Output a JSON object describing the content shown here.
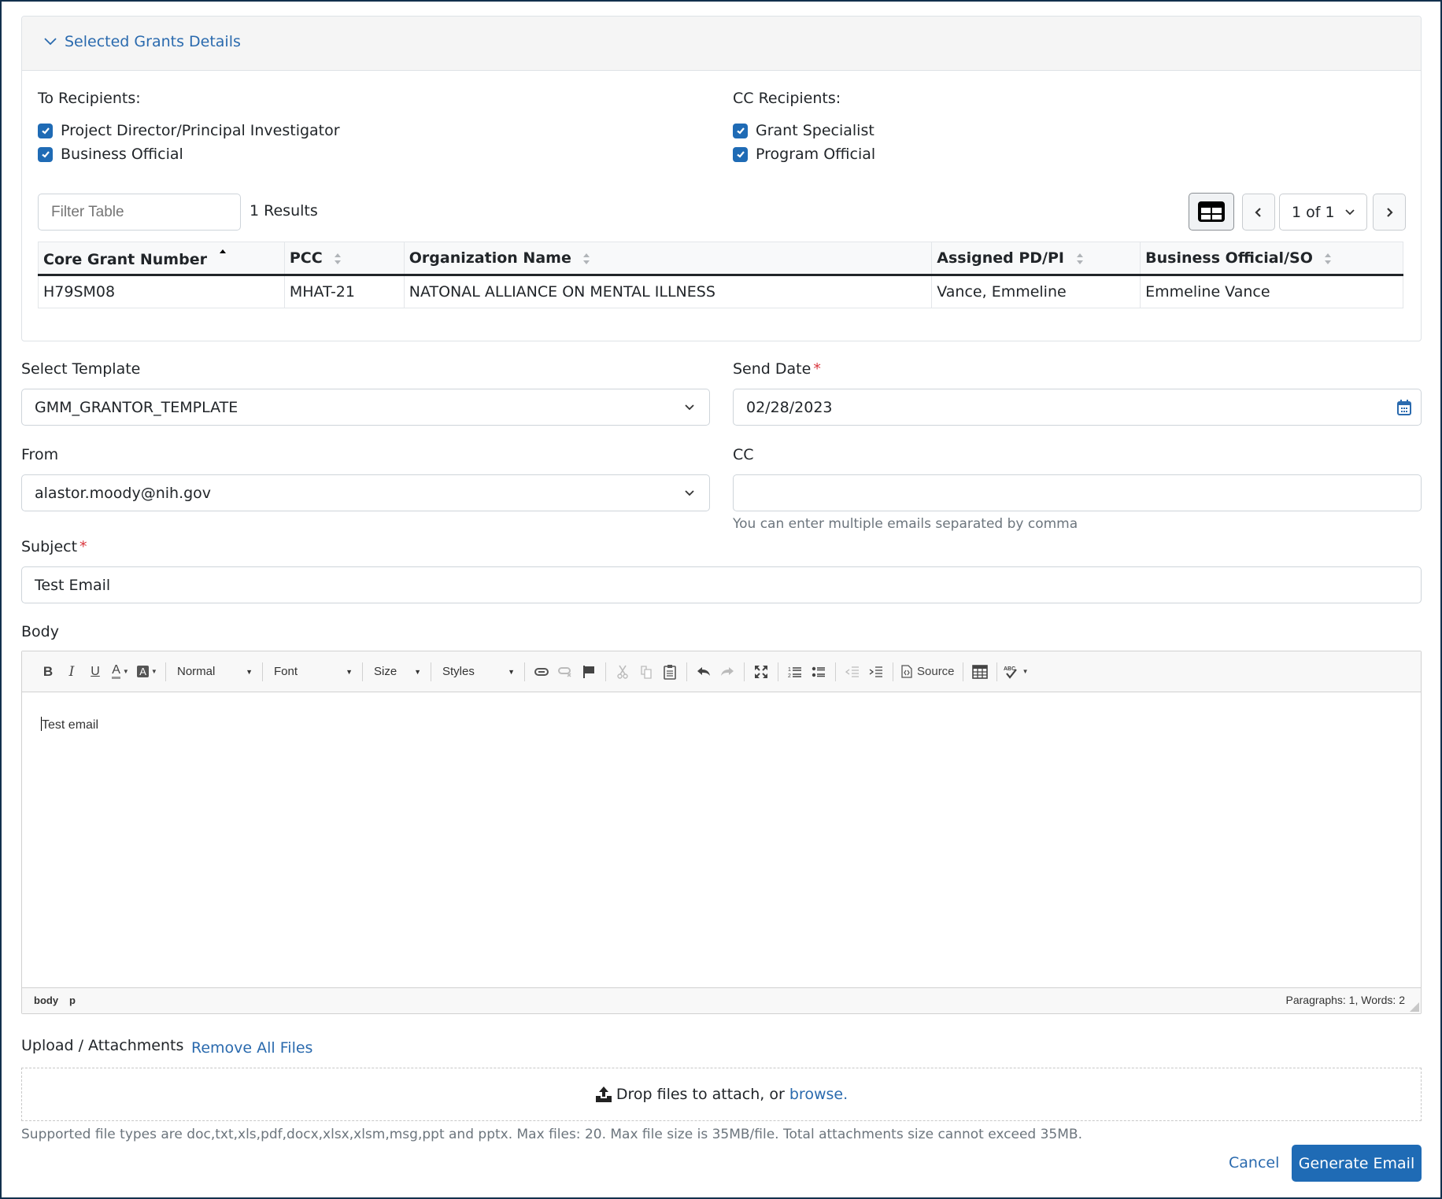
{
  "panel": {
    "title": "Selected Grants Details",
    "to_recipients": {
      "label": "To Recipients:",
      "options": [
        {
          "label": "Project Director/Principal Investigator",
          "checked": true
        },
        {
          "label": "Business Official",
          "checked": true
        }
      ]
    },
    "cc_recipients": {
      "label": "CC Recipients:",
      "options": [
        {
          "label": "Grant Specialist",
          "checked": true
        },
        {
          "label": "Program Official",
          "checked": true
        }
      ]
    },
    "filter": {
      "placeholder": "Filter Table",
      "value": ""
    },
    "results": "1 Results",
    "pagination": {
      "page_label": "1 of 1"
    },
    "icons": {
      "view_toggle": "table-grid-icon",
      "prev": "chevron-left-icon",
      "next": "chevron-right-icon"
    },
    "table": {
      "columns": [
        {
          "label": "Core Grant Number",
          "sort": "asc"
        },
        {
          "label": "PCC",
          "sort": "none"
        },
        {
          "label": "Organization Name",
          "sort": "none"
        },
        {
          "label": "Assigned PD/PI",
          "sort": "none"
        },
        {
          "label": "Business Official/SO",
          "sort": "none"
        }
      ],
      "rows": [
        [
          "H79SM08",
          "MHAT-21",
          "NATONAL ALLIANCE ON MENTAL ILLNESS",
          "Vance, Emmeline",
          "Emmeline Vance"
        ]
      ]
    }
  },
  "form": {
    "template": {
      "label": "Select Template",
      "value": "GMM_GRANTOR_TEMPLATE"
    },
    "send_date": {
      "label": "Send Date",
      "required": "*",
      "value": "02/28/2023"
    },
    "from": {
      "label": "From",
      "value": "alastor.moody@nih.gov"
    },
    "cc": {
      "label": "CC",
      "value": "",
      "help": "You can enter multiple emails separated by comma"
    },
    "subject": {
      "label": "Subject",
      "required": "*",
      "value": "Test Email"
    },
    "body": {
      "label": "Body",
      "toolbar": {
        "format": "Normal",
        "font": "Font",
        "size": "Size",
        "styles": "Styles",
        "source": "Source"
      },
      "content": "Test email",
      "path": [
        "body",
        "p"
      ],
      "stats": "Paragraphs: 1, Words: 2"
    },
    "upload": {
      "label": "Upload / Attachments",
      "remove_all": "Remove All Files",
      "drop_text": "Drop files to attach, or",
      "browse": "browse.",
      "help": "Supported file types are doc,txt,xls,pdf,docx,xlsx,xlsm,msg,ppt and pptx. Max files: 20. Max file size is 35MB/file. Total attachments size cannot exceed 35MB."
    }
  },
  "actions": {
    "cancel": "Cancel",
    "generate": "Generate Email"
  },
  "colors": {
    "primary": "#1f6bb5",
    "link": "#2a6aae",
    "required": "#d9363e",
    "frame": "#12304d"
  }
}
